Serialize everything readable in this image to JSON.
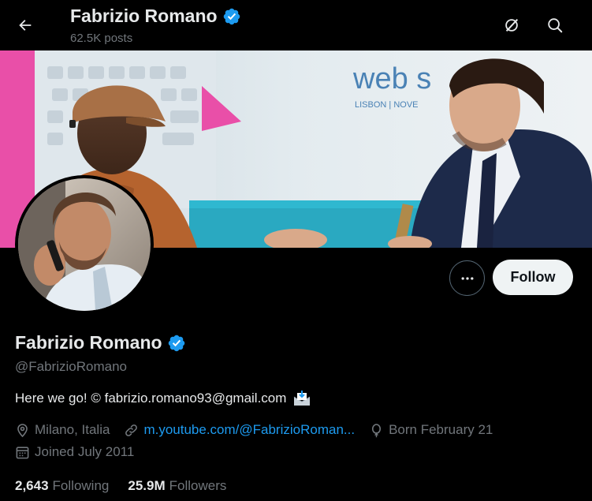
{
  "header": {
    "name": "Fabrizio Romano",
    "posts_count": "62.5K posts",
    "back_icon": "arrow-left-icon",
    "grok_icon": "grok-icon",
    "search_icon": "search-icon"
  },
  "profile": {
    "display_name": "Fabrizio Romano",
    "verified_icon": "verified-badge-icon",
    "handle": "@FabrizioRomano",
    "bio": "Here we go! © fabrizio.romano93@gmail.com",
    "bio_emoji_icon": "envelope-inbox-icon",
    "location": "Milano, Italia",
    "website": "m.youtube.com/@FabrizioRoman...",
    "birthday": "Born February 21",
    "joined": "Joined July 2011"
  },
  "stats": {
    "following_count": "2,643",
    "following_label": "Following",
    "followers_count": "25.9M",
    "followers_label": "Followers"
  },
  "actions": {
    "follow_label": "Follow"
  },
  "banner": {
    "sign_text": "web s",
    "sign_subtext": "LISBON | NOVE"
  },
  "colors": {
    "background": "#000000",
    "primary_text": "#e7e9ea",
    "secondary_text": "#71767b",
    "link": "#1d9bf0",
    "verified": "#1d9bf0",
    "follow_button_bg": "#eff3f4"
  }
}
